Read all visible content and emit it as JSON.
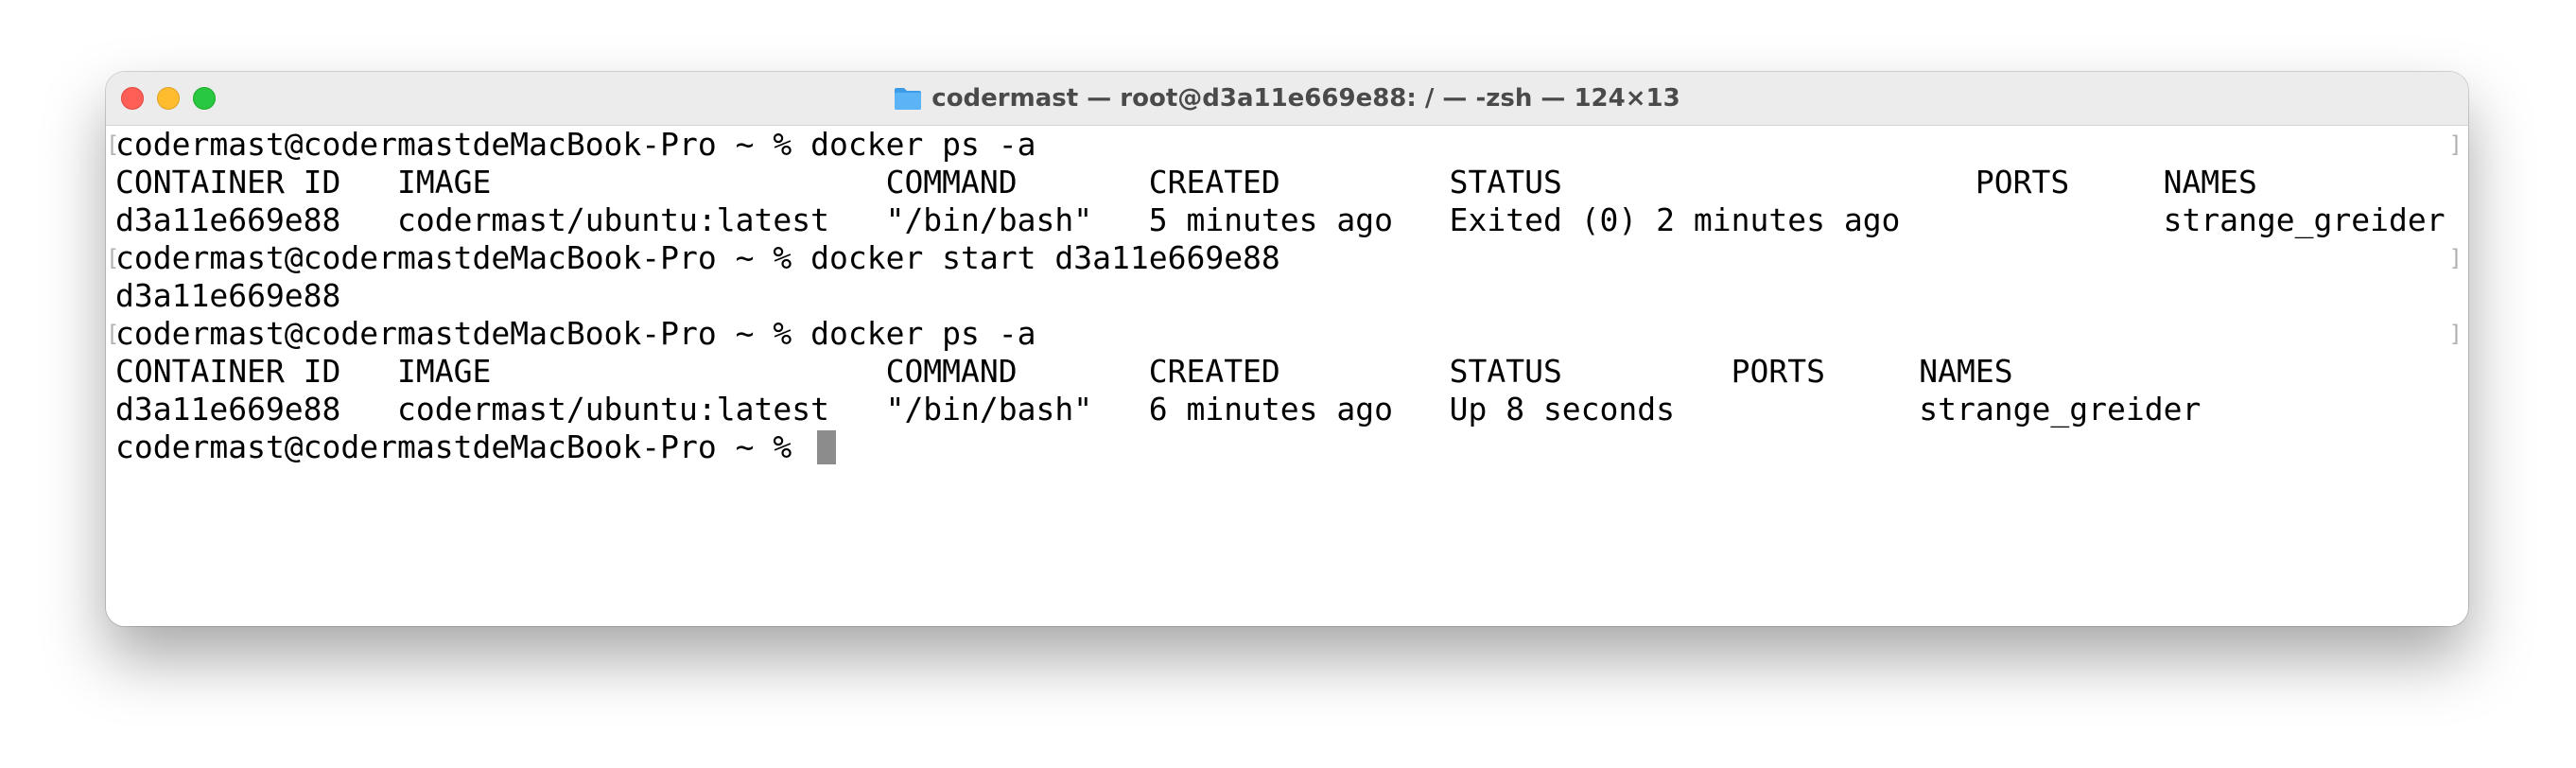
{
  "window": {
    "title": "codermast — root@d3a11e669e88: / — -zsh — 124×13"
  },
  "terminal": {
    "lines": [
      "codermast@codermastdeMacBook-Pro ~ % docker ps -a",
      "CONTAINER ID   IMAGE                     COMMAND       CREATED         STATUS                      PORTS     NAMES",
      "d3a11e669e88   codermast/ubuntu:latest   \"/bin/bash\"   5 minutes ago   Exited (0) 2 minutes ago              strange_greider",
      "codermast@codermastdeMacBook-Pro ~ % docker start d3a11e669e88",
      "d3a11e669e88",
      "codermast@codermastdeMacBook-Pro ~ % docker ps -a",
      "CONTAINER ID   IMAGE                     COMMAND       CREATED         STATUS         PORTS     NAMES",
      "d3a11e669e88   codermast/ubuntu:latest   \"/bin/bash\"   6 minutes ago   Up 8 seconds             strange_greider",
      "codermast@codermastdeMacBook-Pro ~ % "
    ],
    "bracket_left": "[",
    "bracket_right": "]"
  },
  "icons": {
    "folder": "folder-icon"
  },
  "colors": {
    "close": "#ff5f57",
    "minimize": "#febc2e",
    "maximize": "#28c840",
    "folder": "#5ab4f5",
    "cursor": "#8c8c8c"
  }
}
